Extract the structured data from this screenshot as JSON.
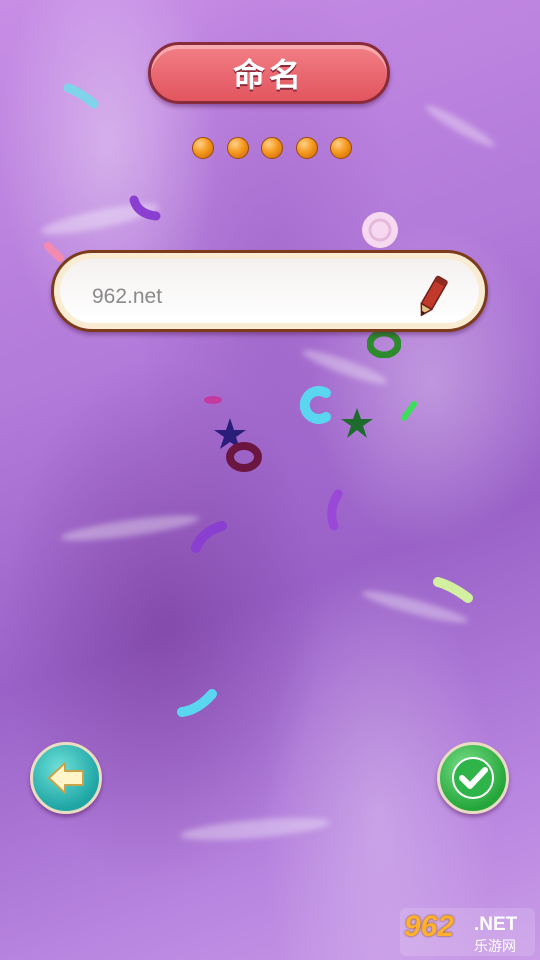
{
  "header": {
    "title": "命名"
  },
  "progress": {
    "total_dots": 5,
    "dot_color": "#f59a1e"
  },
  "name_input": {
    "value": "962.net",
    "icon": "pencil-icon"
  },
  "buttons": {
    "back_icon": "left-arrow-icon",
    "confirm_icon": "checkmark-icon",
    "back_color": "#1ea5a4",
    "confirm_color": "#24a63a"
  },
  "background": {
    "color": "#b27ad9"
  },
  "watermark": {
    "number": "962",
    "net": ".NET",
    "cn": "乐游网"
  }
}
